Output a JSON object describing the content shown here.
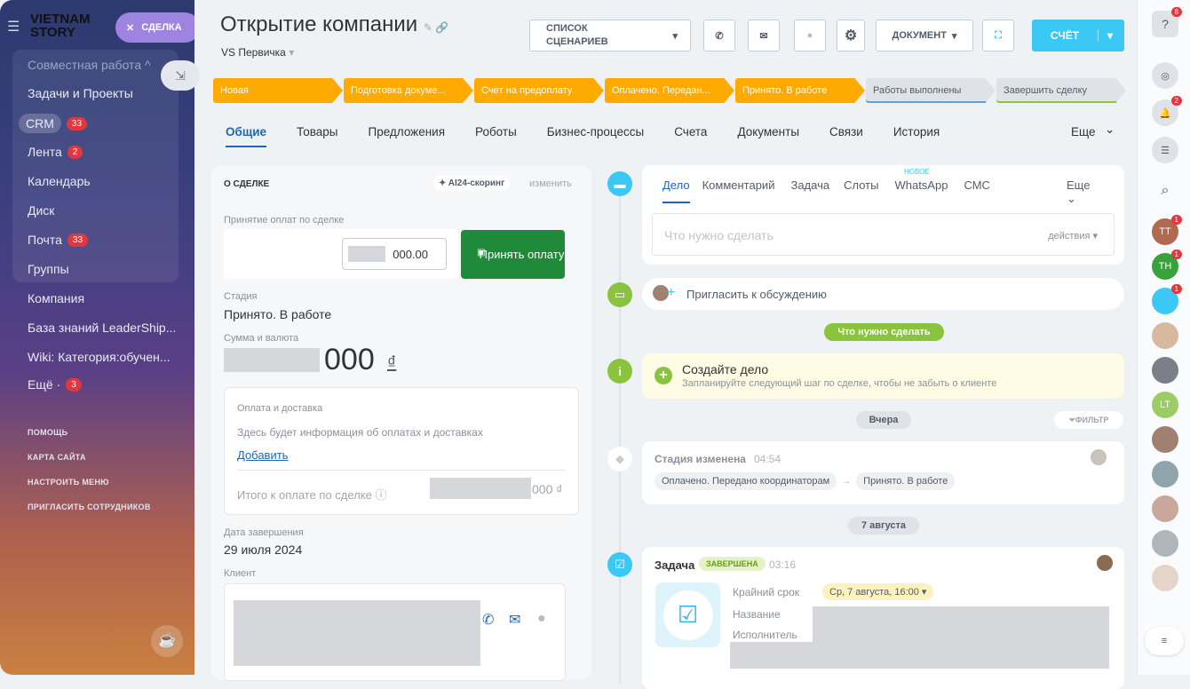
{
  "sidebar": {
    "logo": "VIETNAM STORY",
    "deal_chip": "СДЕЛКА",
    "items": [
      {
        "label": "Совместная работа ^"
      },
      {
        "label": "Задачи и Проекты"
      },
      {
        "label": "CRM",
        "count": "33"
      },
      {
        "label": "Лента",
        "count": "2"
      },
      {
        "label": "Календарь"
      },
      {
        "label": "Диск"
      },
      {
        "label": "Почта",
        "count": "33"
      },
      {
        "label": "Группы"
      },
      {
        "label": "Компания"
      },
      {
        "label": "База знаний LeaderShip..."
      },
      {
        "label": "Wiki: Категория:обучен..."
      },
      {
        "label": "Ещё ·",
        "count": "3"
      }
    ],
    "bottom": [
      "ПОМОЩЬ",
      "КАРТА САЙТА",
      "НАСТРОИТЬ МЕНЮ",
      "ПРИГЛАСИТЬ СОТРУДНИКОВ"
    ]
  },
  "header": {
    "title": "Открытие компании",
    "funnel": "VS Первичка",
    "scenarios": "СПИСОК СЦЕНАРИЕВ",
    "document": "ДОКУМЕНТ",
    "bill": "СЧЁТ"
  },
  "stages": [
    {
      "label": "Новая",
      "done": true
    },
    {
      "label": "Подготовка докуме...",
      "done": true
    },
    {
      "label": "Счёт на предоплату",
      "done": true
    },
    {
      "label": "Оплачено. Передан...",
      "done": true
    },
    {
      "label": "Принято. В работе",
      "done": true
    },
    {
      "label": "Работы выполнены",
      "done": false,
      "color": "#5fa0d8"
    },
    {
      "label": "Завершить сделку",
      "done": false,
      "color": "#8ac43f"
    }
  ],
  "tabs": [
    "Общие",
    "Товары",
    "Предложения",
    "Роботы",
    "Бизнес-процессы",
    "Счета",
    "Документы",
    "Связи",
    "История",
    "Еще"
  ],
  "about": {
    "title": "О СДЕЛКЕ",
    "scoring": "AI24-скоринг",
    "edit": "изменить",
    "payment_label": "Принятие оплат по сделке",
    "amount_input": "000.00",
    "accept_btn": "Принять оплату",
    "stage_label": "Стадия",
    "stage_value": "Принято. В работе",
    "sum_label": "Сумма и валюта",
    "sum_value": "000",
    "currency": "₫",
    "delivery_title": "Оплата и доставка",
    "delivery_text": "Здесь будет информация об оплатах и доставках",
    "add": "Добавить",
    "total_label": "Итого к оплате по сделке",
    "total_value": "000 ₫",
    "close_date_label": "Дата завершения",
    "close_date": "29 июля 2024",
    "client_label": "Клиент"
  },
  "activity": {
    "tabs": [
      "Дело",
      "Комментарий",
      "Задача",
      "Слоты",
      "WhatsApp",
      "СМС",
      "Еще"
    ],
    "new_badge": "НОВОЕ",
    "placeholder": "Что нужно сделать",
    "actions": "действия",
    "invite": "Пригласить к обсуждению",
    "todo_sep": "Что нужно сделать",
    "create_title": "Создайте дело",
    "create_text": "Запланируйте следующий шаг по сделке, чтобы не забыть о клиенте",
    "yesterday": "Вчера",
    "filter": "ФИЛЬТР",
    "stage_changed": "Стадия изменена",
    "stage_time": "04:54",
    "from_stage": "Оплачено. Передано координаторам",
    "to_stage": "Принято. В работе",
    "aug7": "7 августа",
    "task": "Задача",
    "task_status": "ЗАВЕРШЕНА",
    "task_time": "03:16",
    "deadline_label": "Крайний срок",
    "deadline": "Ср, 7 августа, 16:00",
    "name_label": "Название",
    "assignee_label": "Исполнитель"
  },
  "rightbar": {
    "help_count": "8",
    "notif_count": "2",
    "avatars": [
      {
        "initials": "TT",
        "color": "#b06a50",
        "badge": "1"
      },
      {
        "initials": "TH",
        "color": "#3aa23a",
        "badge": "1"
      },
      {
        "initials": "",
        "color": "#3bc8f5",
        "badge": "1"
      },
      {
        "initials": "",
        "color": "#d8b9a0"
      },
      {
        "initials": "",
        "color": "#7a7f88"
      },
      {
        "initials": "LT",
        "color": "#9ccc65"
      },
      {
        "initials": "",
        "color": "#a08070"
      },
      {
        "initials": "",
        "color": "#90a4ae"
      },
      {
        "initials": "",
        "color": "#c7a89a"
      },
      {
        "initials": "",
        "color": "#b0b5ba"
      },
      {
        "initials": "",
        "color": "#e4d5c8"
      }
    ]
  }
}
